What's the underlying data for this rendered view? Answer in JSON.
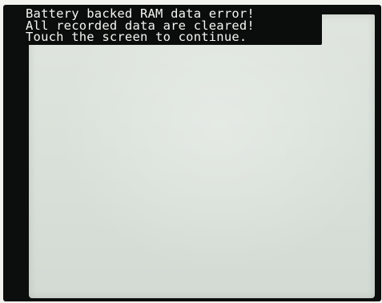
{
  "screen": {
    "message_lines": [
      "Battery backed RAM data error!",
      "All recorded data are cleared!",
      "Touch the screen to continue."
    ]
  }
}
